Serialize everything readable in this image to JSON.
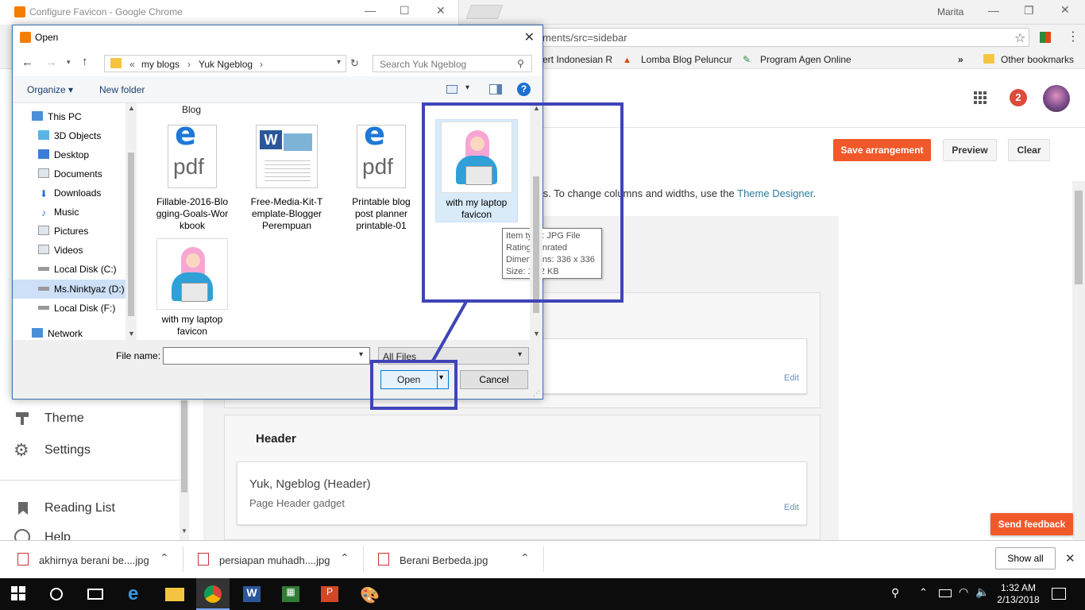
{
  "chrome": {
    "window_title": "Configure Favicon - Google Chrome",
    "user": "Marita",
    "url_fragment": "ments/src=sidebar",
    "bookmarks": [
      "ert Indonesian R",
      "Lomba Blog Peluncur",
      "Program Agen Online"
    ],
    "other_bookmarks": "Other bookmarks",
    "bookmarks_overflow": "»"
  },
  "blogger": {
    "notification_count": "2",
    "save_label": "Save arrangement",
    "preview_label": "Preview",
    "clear_label": "Clear",
    "hint_text": "ts. To change columns and widths, use the ",
    "hint_link": "Theme Designer",
    "hint_end": ".",
    "edit_label": "Edit",
    "header_section_title": "Header",
    "header_gadget_title": "Yuk, Ngeblog (Header)",
    "header_gadget_sub": "Page Header gadget",
    "send_feedback": "Send feedback",
    "nav": [
      {
        "label": "Theme"
      },
      {
        "label": "Settings"
      },
      {
        "label": "Reading List"
      },
      {
        "label": "Help"
      }
    ]
  },
  "downloads": {
    "items": [
      {
        "name": "akhirnya berani be....jpg"
      },
      {
        "name": "persiapan muhadh....jpg"
      },
      {
        "name": "Berani Berbeda.jpg"
      }
    ],
    "show_all": "Show all",
    "close": "✕"
  },
  "taskbar": {
    "time": "1:32 AM",
    "date": "2/13/2018"
  },
  "dialog": {
    "title": "Open",
    "breadcrumb": [
      "«",
      "my blogs",
      "›",
      "Yuk Ngeblog",
      "›"
    ],
    "search_placeholder": "Search Yuk Ngeblog",
    "organize": "Organize ▾",
    "new_folder": "New folder",
    "tree": [
      {
        "label": "This PC"
      },
      {
        "label": "3D Objects"
      },
      {
        "label": "Desktop"
      },
      {
        "label": "Documents"
      },
      {
        "label": "Downloads"
      },
      {
        "label": "Music"
      },
      {
        "label": "Pictures"
      },
      {
        "label": "Videos"
      },
      {
        "label": "Local Disk (C:)"
      },
      {
        "label": "Ms.Ninktyaz (D:)"
      },
      {
        "label": "Local Disk (F:)"
      },
      {
        "label": "Network"
      }
    ],
    "files_partial_label": "Blog",
    "files": [
      {
        "name": "Fillable-2016-Blo gging-Goals-Wor kbook",
        "line1": "Fillable-2016-Blo",
        "line2": "gging-Goals-Wor",
        "line3": "kbook"
      },
      {
        "name": "Free-Media-Kit-Template-Blogger Perempuan",
        "line1": "Free-Media-Kit-T",
        "line2": "emplate-Blogger",
        "line3": "Perempuan"
      },
      {
        "name": "Printable blog post planner printable-01",
        "line1": "Printable blog",
        "line2": "post planner",
        "line3": "printable-01"
      },
      {
        "name": "with my laptop favicon",
        "line1": "with my laptop",
        "line2": "favicon",
        "line3": ""
      },
      {
        "name": "with my laptop favicon",
        "line1": "with my laptop",
        "line2": "favicon",
        "line3": ""
      }
    ],
    "tooltip": {
      "type": "Item type: JPG File",
      "rating": "Rating: Unrated",
      "dimensions": "Dimensions: 336 x 336",
      "size": "Size: 14.2 KB"
    },
    "file_name_label": "File name:",
    "file_name_value": "",
    "file_type": "All Files",
    "open_label": "Open",
    "cancel_label": "Cancel"
  },
  "colors": {
    "accent_orange": "#f1592a",
    "annotation_blue": "#3f44b8",
    "selection": "#cde0f7"
  }
}
